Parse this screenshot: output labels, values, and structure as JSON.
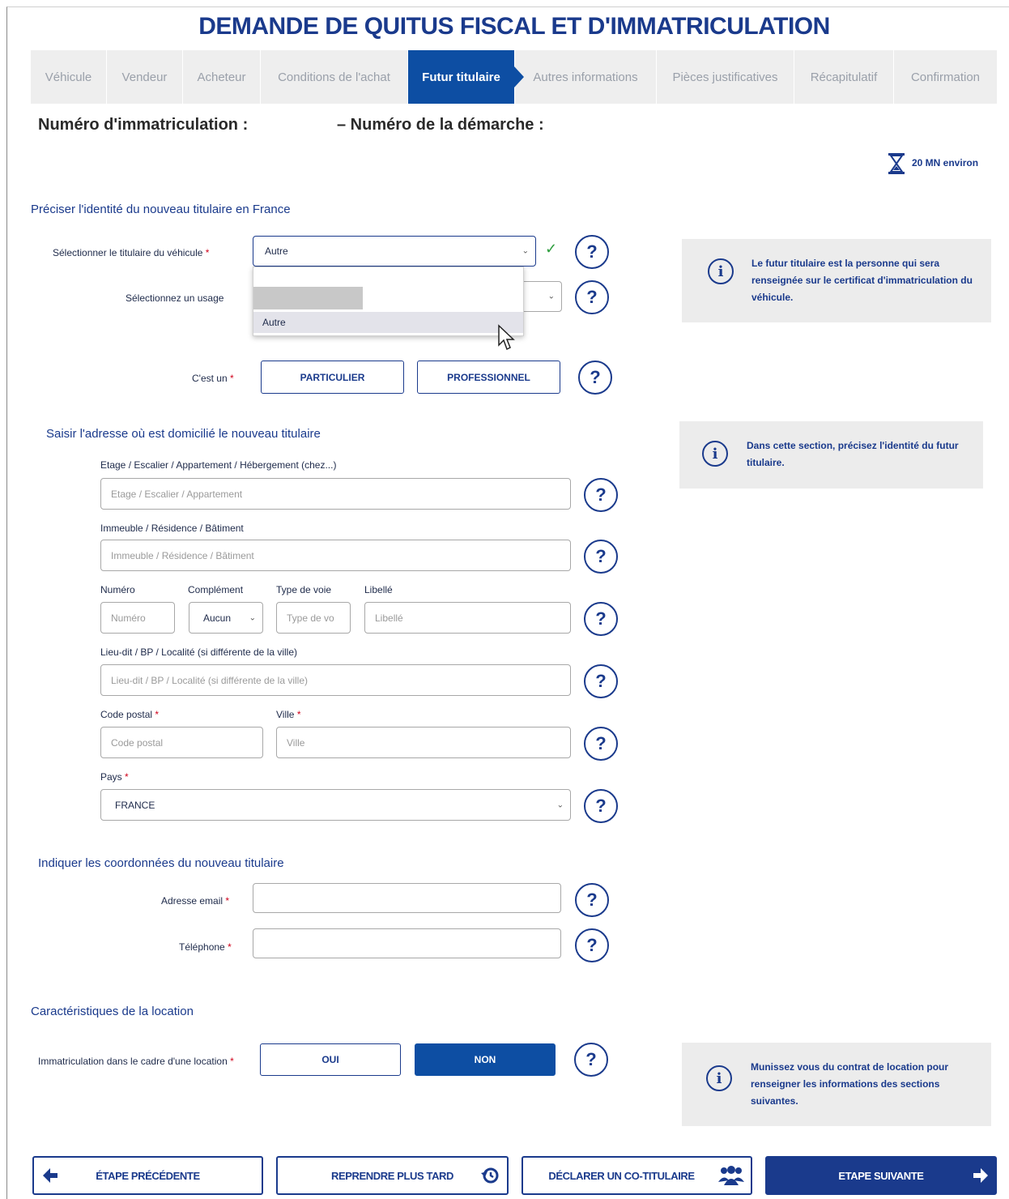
{
  "page": {
    "title": "DEMANDE DE QUITUS FISCAL ET D'IMMATRICULATION",
    "duration": "20 MN environ"
  },
  "steps": [
    {
      "label": "Véhicule",
      "active": false
    },
    {
      "label": "Vendeur",
      "active": false
    },
    {
      "label": "Acheteur",
      "active": false
    },
    {
      "label": "Conditions de l'achat",
      "active": false
    },
    {
      "label": "Futur titulaire",
      "active": true
    },
    {
      "label": "Autres informations",
      "active": false
    },
    {
      "label": "Pièces justificatives",
      "active": false
    },
    {
      "label": "Récapitulatif",
      "active": false
    },
    {
      "label": "Confirmation",
      "active": false
    }
  ],
  "header": {
    "immat_label": "Numéro d'immatriculation :",
    "demarche_label": "– Numéro de la démarche :"
  },
  "identity": {
    "section_title": "Préciser l'identité du nouveau titulaire en France",
    "holder_label": "Sélectionner le titulaire du véhicule",
    "holder_value": "Autre",
    "dropdown_options": [
      "",
      "Autre"
    ],
    "usage_label": "Sélectionnez un usage",
    "type_label": "C'est un",
    "btn_particulier": "PARTICULIER",
    "btn_professionnel": "PROFESSIONNEL",
    "checkmark": "✓"
  },
  "address": {
    "section_title": "Saisir l'adresse où est domicilié le nouveau titulaire",
    "etage_label": "Etage / Escalier / Appartement / Hébergement (chez...)",
    "etage_placeholder": "Etage / Escalier / Appartement",
    "immeuble_label": "Immeuble / Résidence / Bâtiment",
    "immeuble_placeholder": "Immeuble / Résidence / Bâtiment",
    "numero_label": "Numéro",
    "numero_placeholder": "Numéro",
    "complement_label": "Complément",
    "complement_value": "Aucun",
    "typevoie_label": "Type de voie",
    "typevoie_placeholder": "Type de vo",
    "libelle_label": "Libellé",
    "libelle_placeholder": "Libellé",
    "lieudit_label": "Lieu-dit / BP / Localité (si différente de la ville)",
    "lieudit_placeholder": "Lieu-dit / BP / Localité (si différente de la ville)",
    "cp_label": "Code postal",
    "cp_placeholder": "Code postal",
    "ville_label": "Ville",
    "ville_placeholder": "Ville",
    "pays_label": "Pays",
    "pays_value": "FRANCE"
  },
  "contact": {
    "section_title": "Indiquer les coordonnées du nouveau titulaire",
    "email_label": "Adresse email",
    "tel_label": "Téléphone"
  },
  "location": {
    "section_title": "Caractéristiques de la location",
    "question": "Immatriculation dans le cadre d'une location",
    "btn_oui": "OUI",
    "btn_non": "NON"
  },
  "info_boxes": {
    "box1": "Le futur titulaire est la personne qui sera renseignée sur le certificat d'immatriculation du véhicule.",
    "box2": "Dans cette section, précisez l'identité du futur titulaire.",
    "box3": "Munissez vous du contrat de location pour renseigner les informations des sections suivantes."
  },
  "footer": {
    "prev": "ÉTAPE PRÉCÉDENTE",
    "later": "REPRENDRE PLUS TARD",
    "cotitulaire": "DÉCLARER UN CO-TITULAIRE",
    "next": "ETAPE SUIVANTE"
  },
  "common": {
    "required_mark": "*",
    "help_glyph": "?",
    "info_glyph": "i"
  },
  "colors": {
    "brand": "#1a3a8c",
    "active_step": "#0d4ea3",
    "required": "#d0021b",
    "valid": "#2e9e3e"
  }
}
